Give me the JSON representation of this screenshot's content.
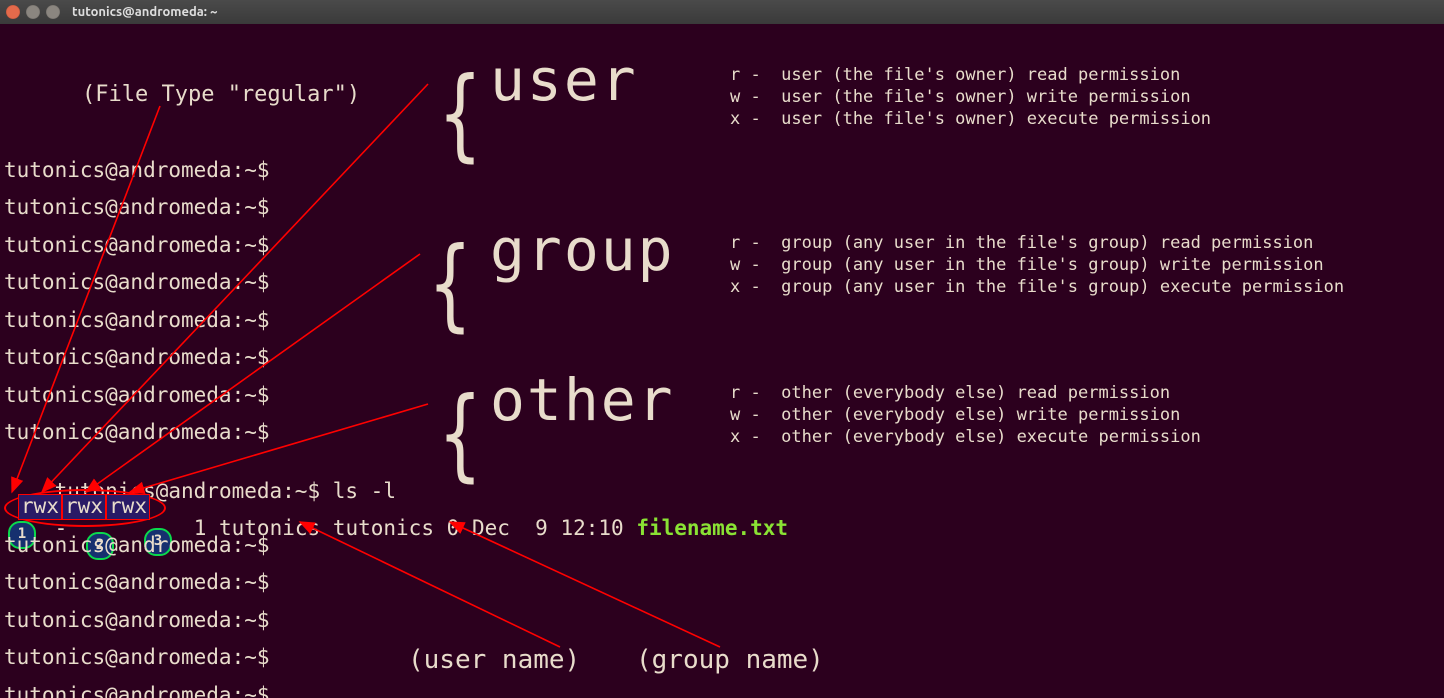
{
  "window": {
    "title": "tutonics@andromeda: ~"
  },
  "annotations": {
    "file_type": "(File Type \"regular\")",
    "user_label": "user",
    "group_label": "group",
    "other_label": "other",
    "user_desc": "r -  user (the file's owner) read permission\nw -  user (the file's owner) write permission\nx -  user (the file's owner) execute permission",
    "group_desc": "r -  group (any user in the file's group) read permission\nw -  group (any user in the file's group) write permission\nx -  group (any user in the file's group) execute permission",
    "other_desc": "r -  other (everybody else) read permission\nw -  other (everybody else) write permission\nx -  other (everybody else) execute permission",
    "user_name_label": "(user name)",
    "group_name_label": "(group name)"
  },
  "prompt": "tutonics@andromeda:~$",
  "command": "ls -l",
  "ls_output": {
    "file_type_char": "-",
    "perm_user": "rwx",
    "perm_group": "rwx",
    "perm_other": "rwx",
    "links": "1",
    "owner": "tutonics",
    "group": "tutonics",
    "size": "0",
    "date": "Dec  9 12:10",
    "filename": "filename.txt"
  },
  "nums": {
    "one": "1",
    "two": "2",
    "three": "3"
  }
}
